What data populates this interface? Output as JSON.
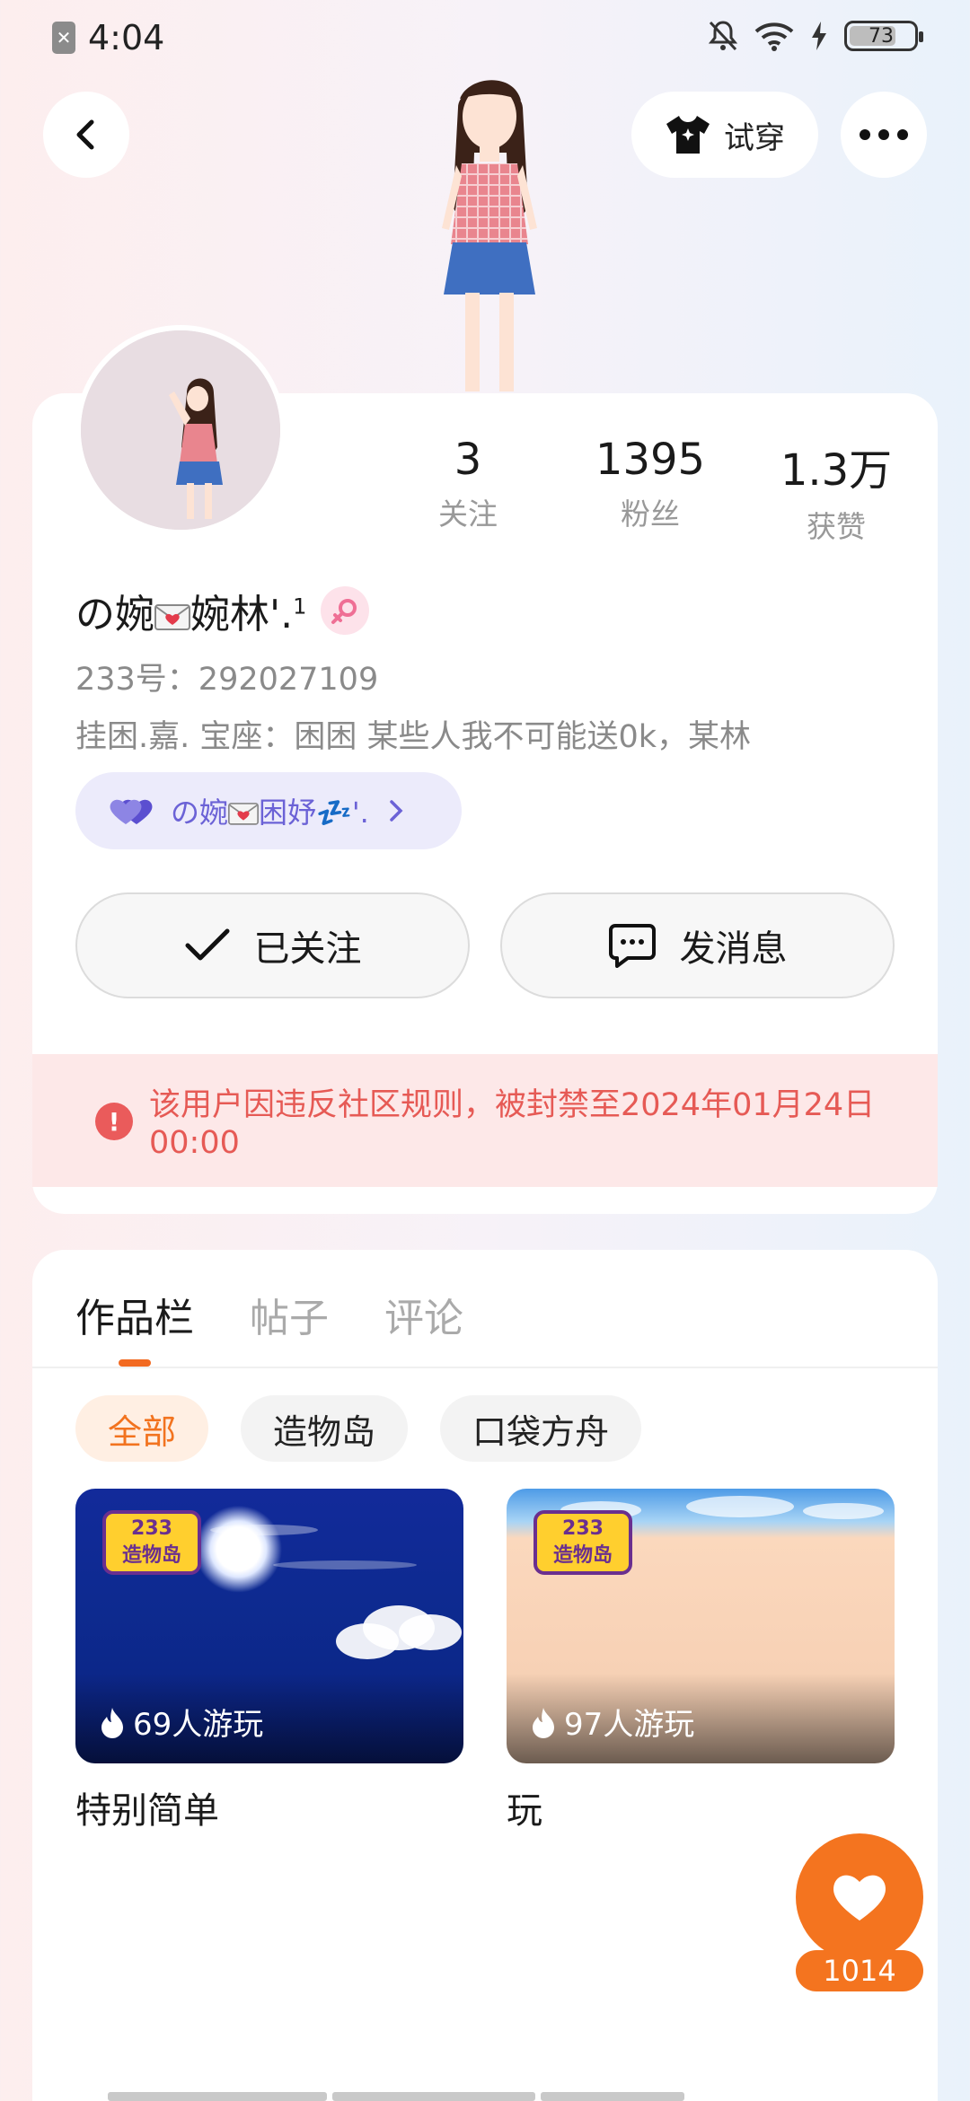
{
  "status_bar": {
    "time": "4:04",
    "battery": "73",
    "battery_level": 0.73
  },
  "header": {
    "try_on_label": "试穿"
  },
  "profile": {
    "stats": [
      {
        "value": "3",
        "label": "关注"
      },
      {
        "value": "1395",
        "label": "粉丝"
      },
      {
        "value": "1.3万",
        "label": "获赞"
      }
    ],
    "name_part1": "の婉",
    "name_part2": "婉林'.",
    "name_sup": "1",
    "user_id": "233号：292027109",
    "bio": "挂困.嘉.   宝座：困困    某些人我不可能送0k，某林",
    "group_prefix": "の婉",
    "group_suffix": "困妤💤'.",
    "follow_label": "已关注",
    "message_label": "发消息",
    "ban_notice": "该用户因违反社区规则，被封禁至2024年01月24日 00:00"
  },
  "works": {
    "tabs": [
      "作品栏",
      "帖子",
      "评论"
    ],
    "filters": [
      "全部",
      "造物岛",
      "口袋方舟"
    ],
    "items": [
      {
        "plays": "69人游玩",
        "title": "特别简单",
        "logo_top": "233",
        "logo_bottom": "造物岛"
      },
      {
        "plays": "97人游玩",
        "title": "玩",
        "logo_top": "233",
        "logo_bottom": "造物岛"
      }
    ],
    "like_count": "1014"
  },
  "colors": {
    "accent": "#f4741f",
    "ban_text": "#e65a55",
    "group_text": "#6b62d6"
  }
}
